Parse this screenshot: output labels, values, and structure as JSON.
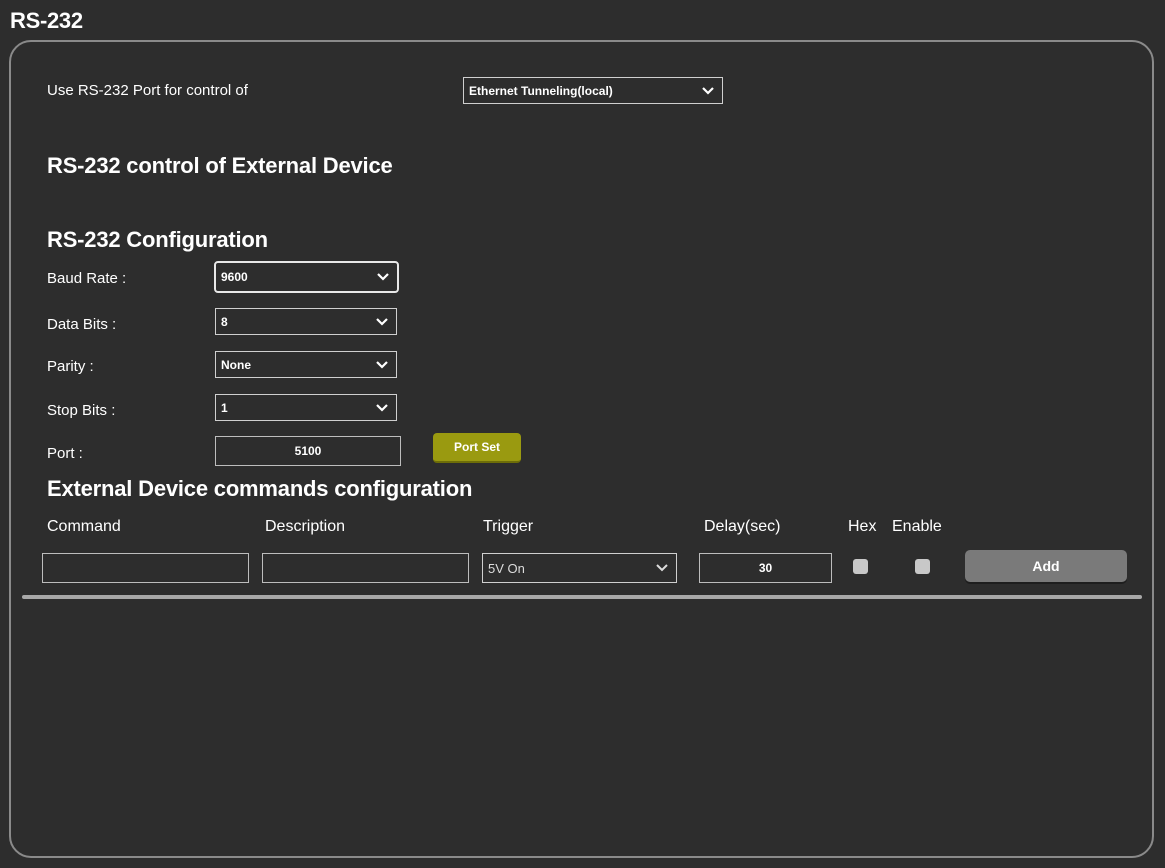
{
  "page": {
    "title": "RS-232"
  },
  "control": {
    "label": "Use RS-232 Port for control of",
    "selected": "Ethernet Tunneling(local)"
  },
  "sections": {
    "external_device": "RS-232 control of External Device",
    "configuration": "RS-232 Configuration",
    "commands": "External Device commands configuration"
  },
  "config": {
    "baud_rate": {
      "label": "Baud Rate :",
      "value": "9600"
    },
    "data_bits": {
      "label": "Data Bits :",
      "value": "8"
    },
    "parity": {
      "label": "Parity :",
      "value": "None"
    },
    "stop_bits": {
      "label": "Stop Bits :",
      "value": "1"
    },
    "port": {
      "label": "Port :",
      "value": "5100"
    },
    "port_set_label": "Port Set"
  },
  "commands": {
    "headers": {
      "command": "Command",
      "description": "Description",
      "trigger": "Trigger",
      "delay": "Delay(sec)",
      "hex": "Hex",
      "enable": "Enable"
    },
    "row": {
      "command": "",
      "description": "",
      "trigger": "5V On",
      "delay": "30",
      "hex_checked": false,
      "enable_checked": false
    },
    "add_label": "Add"
  },
  "icons": {
    "select_arrow": "chevron-down-icon"
  },
  "colors": {
    "background": "#2d2d2d",
    "port_set_button": "#9a9a10",
    "add_button": "#7a7a7a"
  }
}
